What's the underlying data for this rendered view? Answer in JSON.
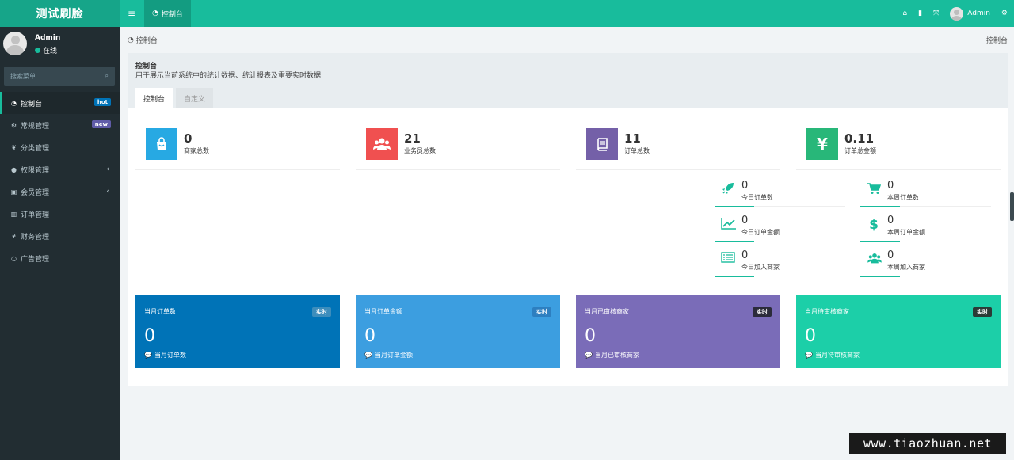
{
  "header": {
    "brand": "测试刷脸",
    "tab_label": "控制台",
    "user_name": "Admin"
  },
  "sidebar": {
    "user_name": "Admin",
    "user_status": "在线",
    "search_placeholder": "搜索菜单",
    "items": [
      {
        "label": "控制台",
        "badge": "hot",
        "icon": "dashboard-icon"
      },
      {
        "label": "常规管理",
        "badge": "new",
        "icon": "cogs-icon"
      },
      {
        "label": "分类管理",
        "icon": "leaf-icon"
      },
      {
        "label": "权限管理",
        "icon": "group-icon"
      },
      {
        "label": "会员管理",
        "icon": "user-card-icon"
      },
      {
        "label": "订单管理",
        "icon": "bar-chart-icon"
      },
      {
        "label": "财务管理",
        "icon": "yen-icon"
      },
      {
        "label": "广告管理",
        "icon": "circle-icon"
      }
    ]
  },
  "breadcrumb": {
    "left": "控制台",
    "right": "控制台"
  },
  "panel": {
    "title": "控制台",
    "description": "用于展示当前系统中的统计数据、统计报表及重要实时数据",
    "tabs": [
      "控制台",
      "自定义"
    ]
  },
  "stats": [
    {
      "value": "0",
      "label": "商家总数",
      "color": "#27a9e3",
      "icon": "shopping-bag-icon"
    },
    {
      "value": "21",
      "label": "业务员总数",
      "color": "#f05050",
      "icon": "users-icon"
    },
    {
      "value": "11",
      "label": "订单总数",
      "color": "#7460a8",
      "icon": "book-icon"
    },
    {
      "value": "0.11",
      "label": "订单总金额",
      "color": "#28b779",
      "icon": "yen-icon"
    }
  ],
  "mini_stats": [
    {
      "value": "0",
      "label": "今日订单数",
      "icon": "rocket-icon"
    },
    {
      "value": "0",
      "label": "本周订单数",
      "icon": "cart-icon"
    },
    {
      "value": "0",
      "label": "今日订单金额",
      "icon": "line-chart-icon"
    },
    {
      "value": "0",
      "label": "本周订单金额",
      "icon": "dollar-icon"
    },
    {
      "value": "0",
      "label": "今日加入商家",
      "icon": "list-icon"
    },
    {
      "value": "0",
      "label": "本周加入商家",
      "icon": "users-icon"
    }
  ],
  "cards": [
    {
      "title": "当月订单数",
      "badge": "实时",
      "value": "0",
      "footer": "当月订单数",
      "color": "#0073b7",
      "badge_color": "#3c8dbc"
    },
    {
      "title": "当月订单金额",
      "badge": "实时",
      "value": "0",
      "footer": "当月订单金额",
      "color": "#3c9ee0",
      "badge_color": "#2d7fc0"
    },
    {
      "title": "当月已审核商家",
      "badge": "实时",
      "value": "0",
      "footer": "当月已审核商家",
      "color": "#7a6cb8",
      "badge_color": "#2b2b3a"
    },
    {
      "title": "当月待审核商家",
      "badge": "实时",
      "value": "0",
      "footer": "当月待审核商家",
      "color": "#1ccfa8",
      "badge_color": "#2b3a36"
    }
  ],
  "watermark": "www.tiaozhuan.net"
}
